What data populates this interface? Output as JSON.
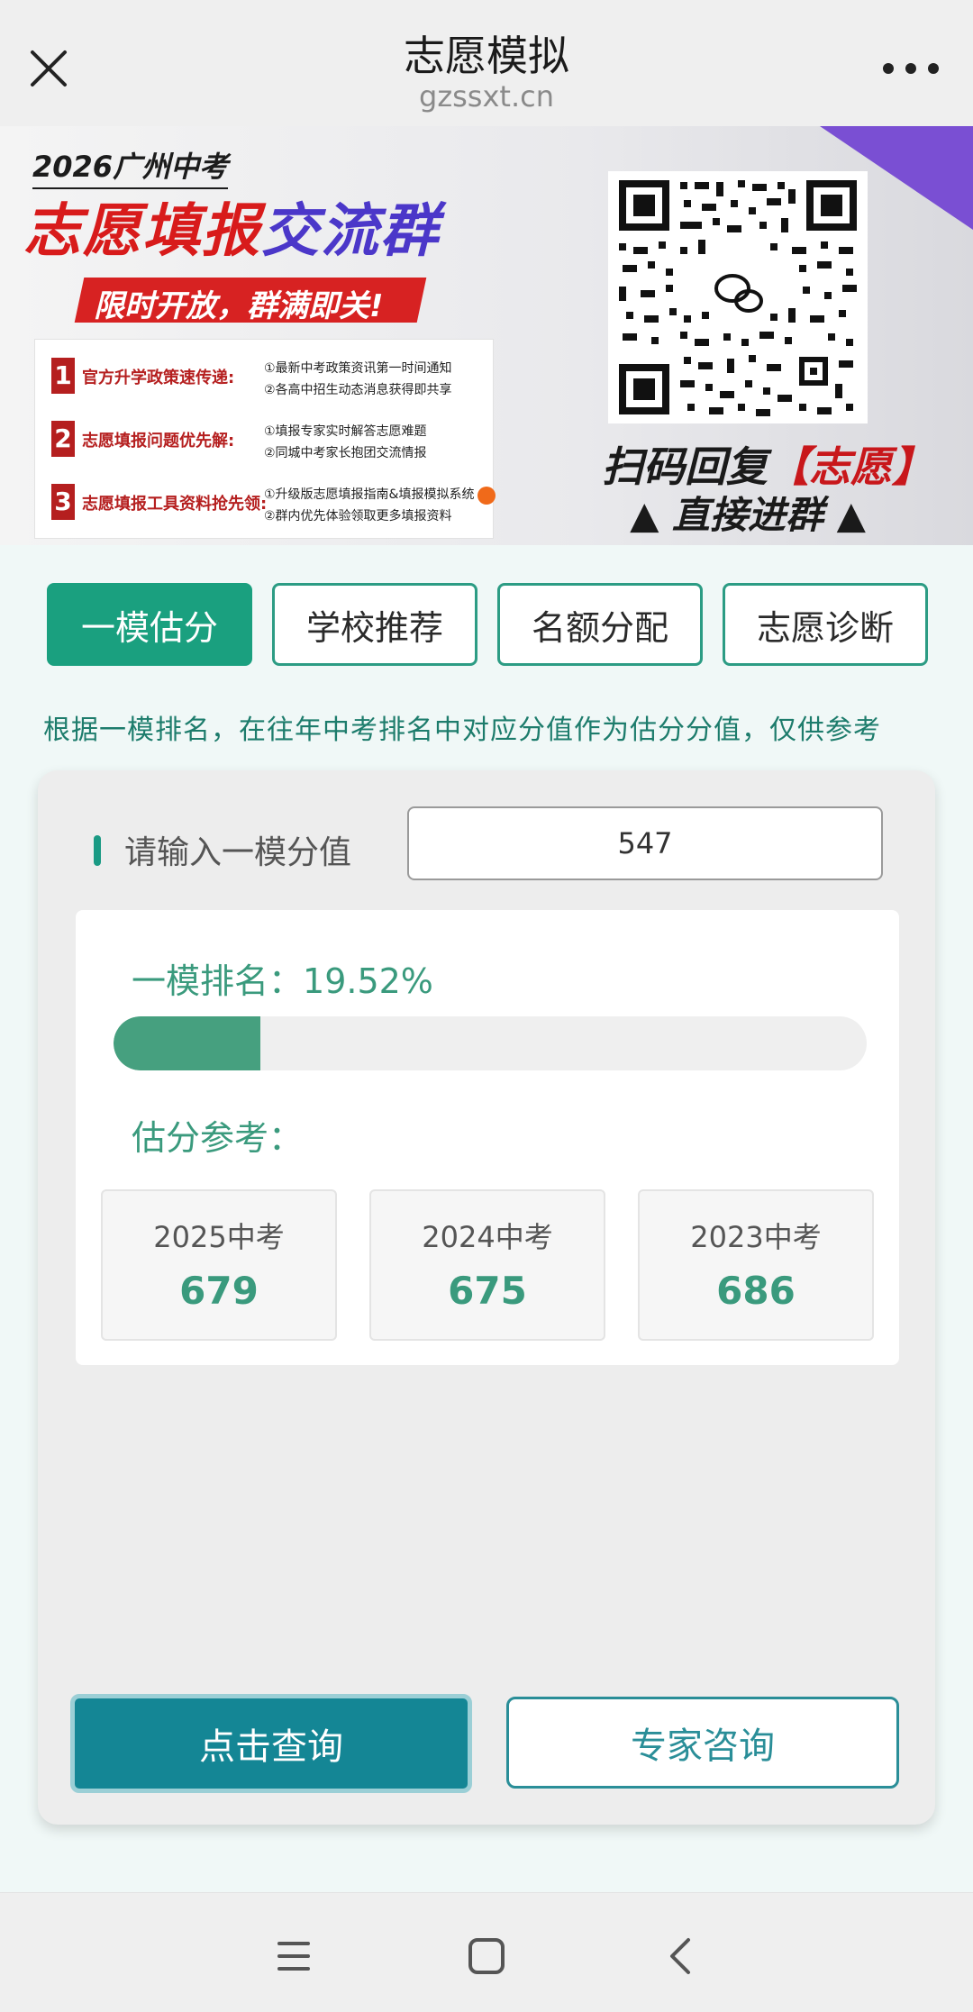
{
  "header": {
    "title": "志愿模拟",
    "domain": "gzssxt.cn"
  },
  "icons": {
    "close": "close-icon",
    "more": "more-dots-icon",
    "qr": "qr-code-icon",
    "nav_menu": "menu-icon",
    "nav_home": "home-square-icon",
    "nav_back": "back-chevron-icon"
  },
  "banner": {
    "year_tag": "2026广州中考",
    "headline_red": "志愿填报",
    "headline_purple": "交流群",
    "ribbon": "限时开放，群满即关!",
    "items": [
      {
        "num": "1",
        "title": "官方升学政策速传递:",
        "subs": [
          "①最新中考政策资讯第一时间通知",
          "②各高中招生动态消息获得即共享"
        ]
      },
      {
        "num": "2",
        "title": "志愿填报问题优先解:",
        "subs": [
          "①填报专家实时解答志愿难题",
          "②同城中考家长抱团交流情报"
        ]
      },
      {
        "num": "3",
        "title": "志愿填报工具资料抢先领:",
        "subs": [
          "①升级版志愿填报指南&填报模拟系统",
          "②群内优先体验领取更多填报资料"
        ]
      }
    ],
    "scan_text_1": "扫码回复",
    "scan_highlight": "【志愿】",
    "join_text": "▲ 直接进群 ▲"
  },
  "tabs": [
    {
      "label": "一模估分",
      "active": true
    },
    {
      "label": "学校推荐",
      "active": false
    },
    {
      "label": "名额分配",
      "active": false
    },
    {
      "label": "志愿诊断",
      "active": false
    }
  ],
  "notice": "根据一模排名，在往年中考排名中对应分值作为估分分值，仅供参考",
  "form": {
    "label": "请输入一模分值",
    "score_value": "547"
  },
  "result": {
    "rank_label": "一模排名：",
    "rank_value": "19.52%",
    "rank_fraction": 0.1952,
    "estimate_label": "估分参考：",
    "years": [
      {
        "label": "2025中考",
        "score": "679"
      },
      {
        "label": "2024中考",
        "score": "675"
      },
      {
        "label": "2023中考",
        "score": "686"
      }
    ]
  },
  "buttons": {
    "query": "点击查询",
    "consult": "专家咨询"
  },
  "colors": {
    "accent_green": "#1aa07f",
    "teal_button": "#148695",
    "banner_red": "#d81b1b",
    "banner_purple": "#4b37c9"
  }
}
